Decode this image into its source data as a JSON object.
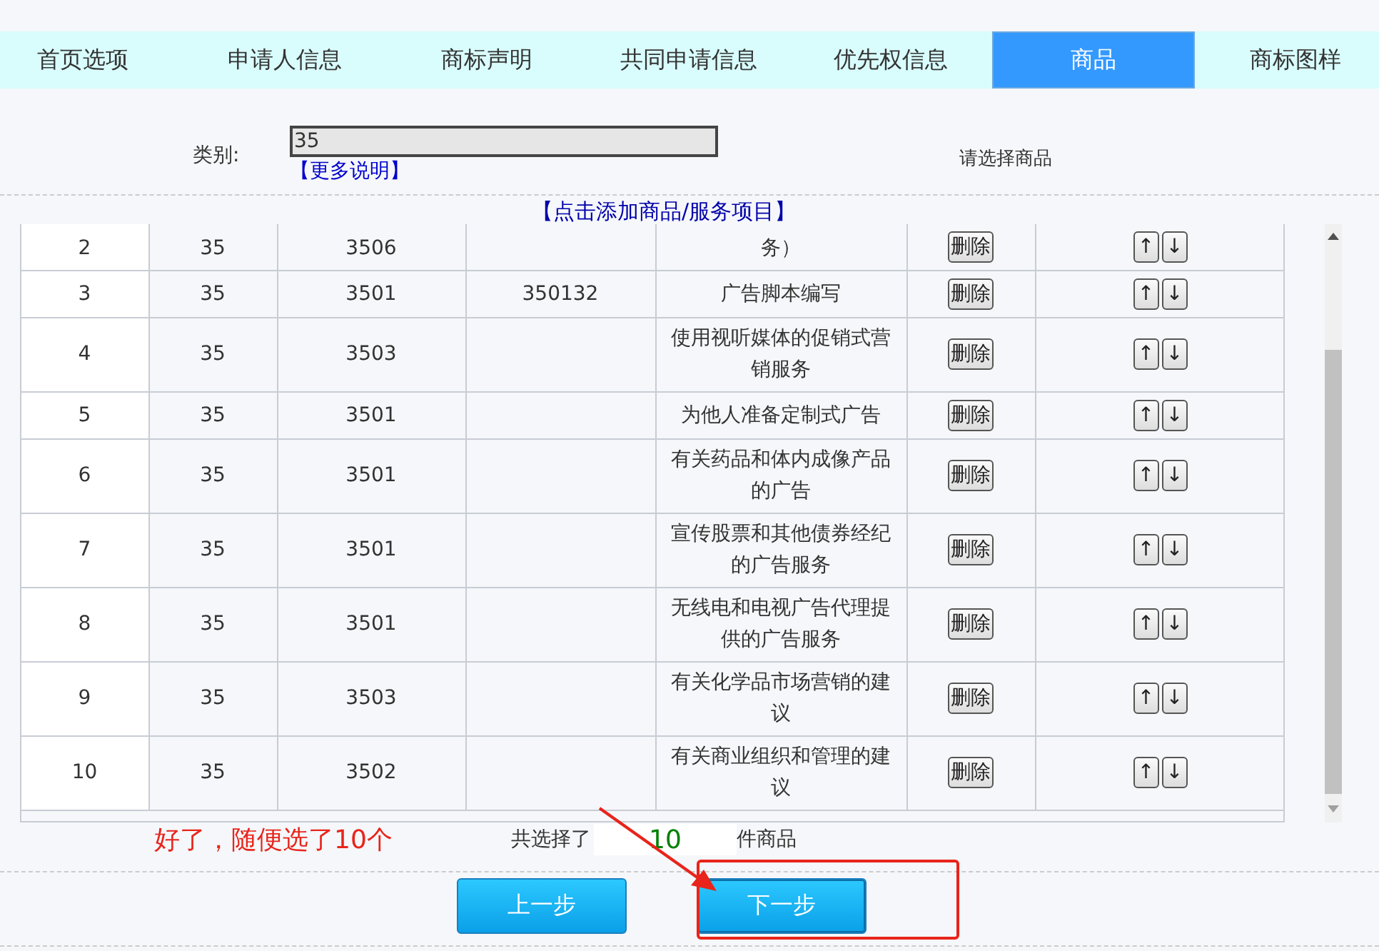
{
  "tabs": [
    {
      "label": "首页选项",
      "selected": false
    },
    {
      "label": "申请人信息",
      "selected": false
    },
    {
      "label": "商标声明",
      "selected": false
    },
    {
      "label": "共同申请信息",
      "selected": false
    },
    {
      "label": "优先权信息",
      "selected": false
    },
    {
      "label": "商品",
      "selected": true
    },
    {
      "label": "商标图样",
      "selected": false
    }
  ],
  "form": {
    "category_label": "类别:",
    "category_value": "35",
    "more_link": "【更多说明】",
    "hint": "请选择商品",
    "add_link": "【点击添加商品/服务项目】"
  },
  "table": {
    "rows": [
      {
        "no": "2",
        "category": "35",
        "group": "3506",
        "item_code": "",
        "item_name": "务）",
        "delete": "删除",
        "up": "↑",
        "down": "↓"
      },
      {
        "no": "3",
        "category": "35",
        "group": "3501",
        "item_code": "350132",
        "item_name": "广告脚本编写",
        "delete": "删除",
        "up": "↑",
        "down": "↓"
      },
      {
        "no": "4",
        "category": "35",
        "group": "3503",
        "item_code": "",
        "item_name": "使用视听媒体的促销式营销服务",
        "delete": "删除",
        "up": "↑",
        "down": "↓"
      },
      {
        "no": "5",
        "category": "35",
        "group": "3501",
        "item_code": "",
        "item_name": "为他人准备定制式广告",
        "delete": "删除",
        "up": "↑",
        "down": "↓"
      },
      {
        "no": "6",
        "category": "35",
        "group": "3501",
        "item_code": "",
        "item_name": "有关药品和体内成像产品的广告",
        "delete": "删除",
        "up": "↑",
        "down": "↓"
      },
      {
        "no": "7",
        "category": "35",
        "group": "3501",
        "item_code": "",
        "item_name": "宣传股票和其他债券经纪的广告服务",
        "delete": "删除",
        "up": "↑",
        "down": "↓"
      },
      {
        "no": "8",
        "category": "35",
        "group": "3501",
        "item_code": "",
        "item_name": "无线电和电视广告代理提供的广告服务",
        "delete": "删除",
        "up": "↑",
        "down": "↓"
      },
      {
        "no": "9",
        "category": "35",
        "group": "3503",
        "item_code": "",
        "item_name": "有关化学品市场营销的建议",
        "delete": "删除",
        "up": "↑",
        "down": "↓"
      },
      {
        "no": "10",
        "category": "35",
        "group": "3502",
        "item_code": "",
        "item_name": "有关商业组织和管理的建议",
        "delete": "删除",
        "up": "↑",
        "down": "↓"
      }
    ]
  },
  "summary": {
    "prefix": "共选择了",
    "count": "10",
    "suffix": "件商品"
  },
  "annotation": {
    "note": "好了，随便选了10个"
  },
  "buttons": [
    {
      "label": "上一步",
      "highlighted": false
    },
    {
      "label": "下一步",
      "highlighted": true
    }
  ]
}
